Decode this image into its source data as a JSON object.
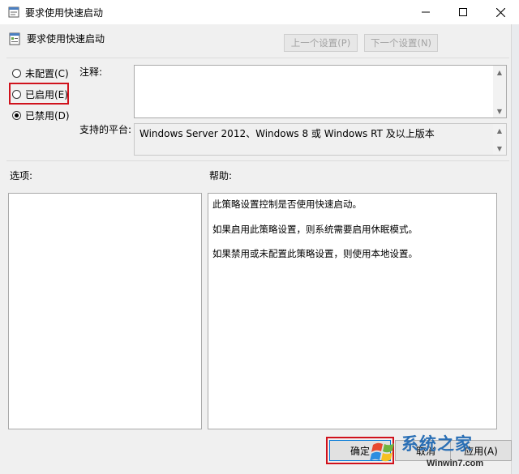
{
  "window": {
    "title": "要求使用快速启动",
    "controls": {
      "minimize_icon": "minimize-icon",
      "maximize_icon": "maximize-icon",
      "close_icon": "close-icon"
    }
  },
  "header": {
    "policy_title": "要求使用快速启动",
    "prev_label": "上一个设置(P)",
    "next_label": "下一个设置(N)"
  },
  "state": {
    "options": [
      {
        "label": "未配置(C)",
        "selected": false
      },
      {
        "label": "已启用(E)",
        "selected": false,
        "highlighted": true
      },
      {
        "label": "已禁用(D)",
        "selected": true
      }
    ]
  },
  "comment": {
    "label": "注释:",
    "value": ""
  },
  "platform": {
    "label": "支持的平台:",
    "value": "Windows Server 2012、Windows 8 或 Windows RT 及以上版本"
  },
  "options_pane": {
    "label": "选项:"
  },
  "help": {
    "label": "帮助:",
    "lines": [
      "此策略设置控制是否使用快速启动。",
      "如果启用此策略设置，则系统需要启用休眠模式。",
      "如果禁用或未配置此策略设置，则使用本地设置。"
    ]
  },
  "footer": {
    "ok_label": "确定",
    "cancel_label": "取消",
    "apply_label": "应用(A)"
  },
  "watermark": {
    "brand": "系统之家",
    "url": "Winwin7.com"
  },
  "colors": {
    "highlight": "#d0121c",
    "accent": "#0078d7",
    "watermark": "#2a6fb5"
  }
}
